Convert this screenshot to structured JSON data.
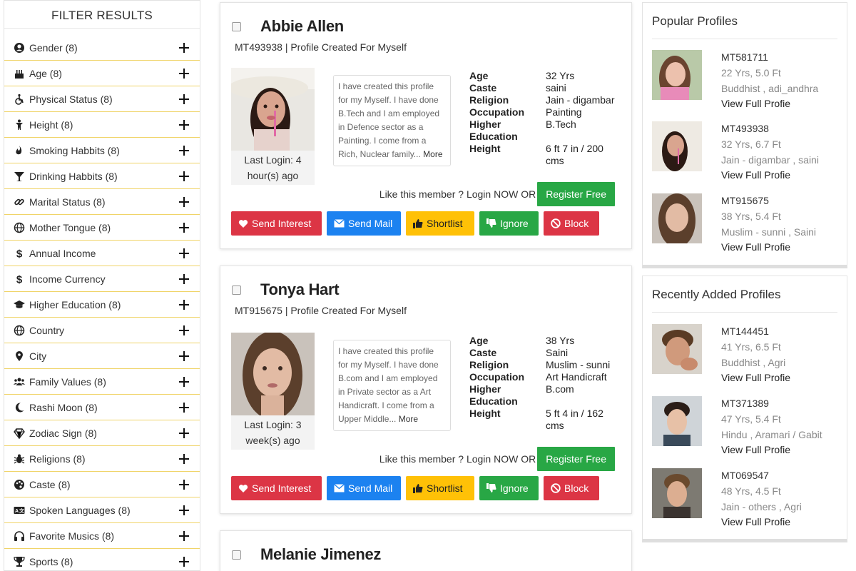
{
  "filter": {
    "title": "FILTER RESULTS",
    "items": [
      {
        "label": "Gender (8)",
        "icon": "user-circle-icon"
      },
      {
        "label": "Age (8)",
        "icon": "birthday-cake-icon"
      },
      {
        "label": "Physical Status (8)",
        "icon": "wheelchair-icon"
      },
      {
        "label": "Height (8)",
        "icon": "child-icon"
      },
      {
        "label": "Smoking Habbits (8)",
        "icon": "fire-icon"
      },
      {
        "label": "Drinking Habbits (8)",
        "icon": "glass-icon"
      },
      {
        "label": "Marital Status (8)",
        "icon": "chain-icon"
      },
      {
        "label": "Mother Tongue (8)",
        "icon": "globe-icon"
      },
      {
        "label": "Annual Income",
        "icon": "dollar-icon"
      },
      {
        "label": "Income Currency",
        "icon": "dollar-icon"
      },
      {
        "label": "Higher Education (8)",
        "icon": "graduation-cap-icon"
      },
      {
        "label": "Country",
        "icon": "globe-icon"
      },
      {
        "label": "City",
        "icon": "map-marker-icon"
      },
      {
        "label": "Family Values (8)",
        "icon": "users-icon"
      },
      {
        "label": "Rashi Moon (8)",
        "icon": "moon-icon"
      },
      {
        "label": "Zodiac Sign (8)",
        "icon": "diamond-icon"
      },
      {
        "label": "Religions (8)",
        "icon": "bug-icon"
      },
      {
        "label": "Caste (8)",
        "icon": "palette-icon"
      },
      {
        "label": "Spoken Languages (8)",
        "icon": "language-icon"
      },
      {
        "label": "Favorite Musics (8)",
        "icon": "headphones-icon"
      },
      {
        "label": "Sports (8)",
        "icon": "trophy-icon"
      }
    ]
  },
  "profiles": [
    {
      "name": "Abbie Allen",
      "id_line": "MT493938 | Profile Created For Myself",
      "last_login": "Last Login: 4 hour(s) ago",
      "about": "I have created this profile for my Myself. I have done B.Tech and I am employed in Defence sector as a Painting. I come from a Rich, Nuclear family...",
      "more": "More",
      "details": [
        {
          "k": "Age",
          "v": "32 Yrs"
        },
        {
          "k": "Caste",
          "v": "saini"
        },
        {
          "k": "Religion",
          "v": "Jain - digambar"
        },
        {
          "k": "Occupation",
          "v": "Painting"
        },
        {
          "k": "Higher Education",
          "v": "B.Tech"
        },
        {
          "k": "Height",
          "v": "6 ft 7 in / 200 cms"
        }
      ]
    },
    {
      "name": "Tonya Hart",
      "id_line": "MT915675 | Profile Created For Myself",
      "last_login": "Last Login: 3 week(s) ago",
      "about": "I have created this profile for my Myself. I have done B.com and I am employed in Private sector as a Art Handicraft. I come from a Upper Middle...",
      "more": "More",
      "details": [
        {
          "k": "Age",
          "v": "38 Yrs"
        },
        {
          "k": "Caste",
          "v": "Saini"
        },
        {
          "k": "Religion",
          "v": "Muslim - sunni"
        },
        {
          "k": "Occupation",
          "v": "Art Handicraft"
        },
        {
          "k": "Higher Education",
          "v": "B.com"
        },
        {
          "k": "Height",
          "v": "5 ft 4 in / 162 cms"
        }
      ]
    },
    {
      "name": "Melanie Jimenez"
    }
  ],
  "card_ui": {
    "like_text": "Like this member ? Login NOW OR",
    "register": "Register Free",
    "send_interest": "Send Interest",
    "send_mail": "Send Mail",
    "shortlist": "Shortlist",
    "ignore": "Ignore",
    "block": "Block"
  },
  "popular": {
    "title": "Popular Profiles",
    "items": [
      {
        "id": "MT581711",
        "age_height": "22 Yrs, 5.0 Ft",
        "religion": "Buddhist , adi_andhra",
        "link": "View Full Profie"
      },
      {
        "id": "MT493938",
        "age_height": "32 Yrs, 6.7 Ft",
        "religion": "Jain - digambar , saini",
        "link": "View Full Profie"
      },
      {
        "id": "MT915675",
        "age_height": "38 Yrs, 5.4 Ft",
        "religion": "Muslim - sunni , Saini",
        "link": "View Full Profie"
      }
    ]
  },
  "recent": {
    "title": "Recently Added Profiles",
    "items": [
      {
        "id": "MT144451",
        "age_height": "41 Yrs, 6.5 Ft",
        "religion": "Buddhist , Agri",
        "link": "View Full Profie"
      },
      {
        "id": "MT371389",
        "age_height": "47 Yrs, 5.4 Ft",
        "religion": "Hindu , Aramari / Gabit",
        "link": "View Full Profie"
      },
      {
        "id": "MT069547",
        "age_height": "48 Yrs, 4.5 Ft",
        "religion": "Jain - others , Agri",
        "link": "View Full Profie"
      }
    ]
  },
  "colors": {
    "filter_divider": "#f0d468",
    "red": "#dc3545",
    "blue": "#1c82f0",
    "yellow": "#ffc107",
    "green": "#28a745"
  }
}
